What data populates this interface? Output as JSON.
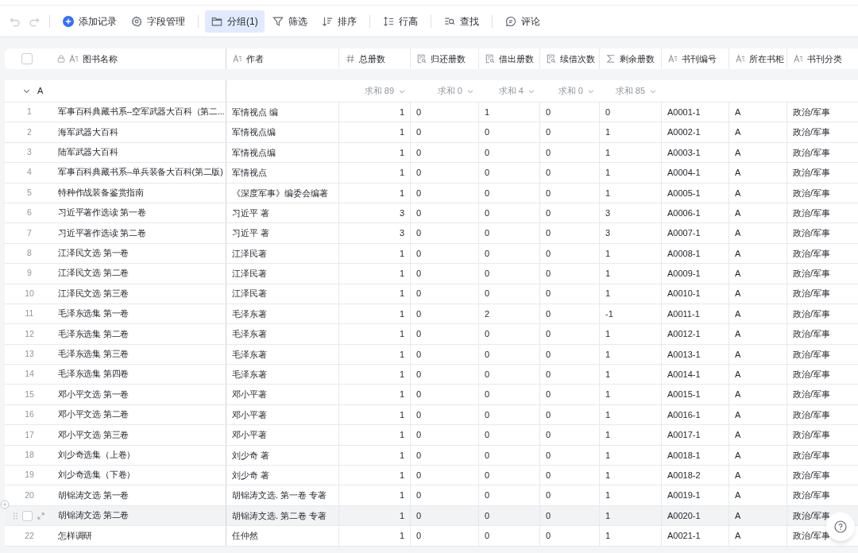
{
  "toolbar": [
    {
      "kind": "undo",
      "disabled": true
    },
    {
      "kind": "redo",
      "disabled": true
    },
    {
      "kind": "separator"
    },
    {
      "kind": "add",
      "label": "添加记录",
      "selected": false
    },
    {
      "kind": "fields",
      "label": "字段管理",
      "selected": false
    },
    {
      "kind": "separator"
    },
    {
      "kind": "group",
      "label": "分组(1)",
      "selected": true
    },
    {
      "kind": "filter",
      "label": "筛选",
      "selected": false
    },
    {
      "kind": "sort",
      "label": "排序",
      "selected": false
    },
    {
      "kind": "separator"
    },
    {
      "kind": "row_height",
      "label": "行高",
      "selected": false
    },
    {
      "kind": "separator"
    },
    {
      "kind": "find",
      "label": "查找",
      "selected": false
    },
    {
      "kind": "separator"
    },
    {
      "kind": "comment",
      "label": "评论",
      "selected": false
    }
  ],
  "table": {
    "select_all": {
      "checked": false
    },
    "columns": [
      {
        "label": "图书名称",
        "kind": "primary"
      },
      {
        "label": "作者",
        "kind": "text"
      },
      {
        "label": "总册数",
        "kind": "number",
        "summary": "求和 89"
      },
      {
        "label": "归还册数",
        "kind": "lookup",
        "summary": "求和 0"
      },
      {
        "label": "借出册数",
        "kind": "lookup",
        "summary": "求和 4"
      },
      {
        "label": "续借次数",
        "kind": "lookup",
        "summary": "求和 0"
      },
      {
        "label": "剩余册数",
        "kind": "formula",
        "summary": "求和 85"
      },
      {
        "label": "书刊编号",
        "kind": "text"
      },
      {
        "label": "所在书柜",
        "kind": "text"
      },
      {
        "label": "书刊分类",
        "kind": "text"
      }
    ],
    "group": {
      "label": "A",
      "expanded": true
    },
    "rows": [
      {
        "index": "1",
        "hovered": false,
        "cells": [
          "军事百科典藏书系--空军武器大百科（第二...",
          "军情视点 编",
          "1",
          "0",
          "1",
          "0",
          "0",
          "A0001-1",
          "A",
          "政治/军事"
        ]
      },
      {
        "index": "2",
        "hovered": false,
        "cells": [
          "海军武器大百科",
          "军情视点编",
          "1",
          "0",
          "0",
          "0",
          "1",
          "A0002-1",
          "A",
          "政治/军事"
        ]
      },
      {
        "index": "3",
        "hovered": false,
        "cells": [
          "陆军武器大百科",
          "军情视点编",
          "1",
          "0",
          "0",
          "0",
          "1",
          "A0003-1",
          "A",
          "政治/军事"
        ]
      },
      {
        "index": "4",
        "hovered": false,
        "cells": [
          "军事百科典藏书系--单兵装备大百科(第二版)",
          "军情视点",
          "1",
          "0",
          "0",
          "0",
          "1",
          "A0004-1",
          "A",
          "政治/军事"
        ]
      },
      {
        "index": "5",
        "hovered": false,
        "cells": [
          "特种作战装备鉴赏指南",
          "《深度军事》编委会编著",
          "1",
          "0",
          "0",
          "0",
          "1",
          "A0005-1",
          "A",
          "政治/军事"
        ]
      },
      {
        "index": "6",
        "hovered": false,
        "cells": [
          "习近平著作选读 第一卷",
          "习近平 著",
          "3",
          "0",
          "0",
          "0",
          "3",
          "A0006-1",
          "A",
          "政治/军事"
        ]
      },
      {
        "index": "7",
        "hovered": false,
        "cells": [
          "习近平著作选读 第二卷",
          "习近平 著",
          "3",
          "0",
          "0",
          "0",
          "3",
          "A0007-1",
          "A",
          "政治/军事"
        ]
      },
      {
        "index": "8",
        "hovered": false,
        "cells": [
          "江泽民文选 第一卷",
          "江泽民著",
          "1",
          "0",
          "0",
          "0",
          "1",
          "A0008-1",
          "A",
          "政治/军事"
        ]
      },
      {
        "index": "9",
        "hovered": false,
        "cells": [
          "江泽民文选 第二卷",
          "江泽民著",
          "1",
          "0",
          "0",
          "0",
          "1",
          "A0009-1",
          "A",
          "政治/军事"
        ]
      },
      {
        "index": "10",
        "hovered": false,
        "cells": [
          "江泽民文选 第三卷",
          "江泽民著",
          "1",
          "0",
          "0",
          "0",
          "1",
          "A0010-1",
          "A",
          "政治/军事"
        ]
      },
      {
        "index": "11",
        "hovered": false,
        "cells": [
          "毛泽东选集 第一卷",
          "毛泽东著",
          "1",
          "0",
          "2",
          "0",
          "-1",
          "A0011-1",
          "A",
          "政治/军事"
        ]
      },
      {
        "index": "12",
        "hovered": false,
        "cells": [
          "毛泽东选集 第二卷",
          "毛泽东著",
          "1",
          "0",
          "0",
          "0",
          "1",
          "A0012-1",
          "A",
          "政治/军事"
        ]
      },
      {
        "index": "13",
        "hovered": false,
        "cells": [
          "毛泽东选集 第三卷",
          "毛泽东著",
          "1",
          "0",
          "0",
          "0",
          "1",
          "A0013-1",
          "A",
          "政治/军事"
        ]
      },
      {
        "index": "14",
        "hovered": false,
        "cells": [
          "毛泽东选集 第四卷",
          "毛泽东著",
          "1",
          "0",
          "0",
          "0",
          "1",
          "A0014-1",
          "A",
          "政治/军事"
        ]
      },
      {
        "index": "15",
        "hovered": false,
        "cells": [
          "邓小平文选 第一卷",
          "邓小平著",
          "1",
          "0",
          "0",
          "0",
          "1",
          "A0015-1",
          "A",
          "政治/军事"
        ]
      },
      {
        "index": "16",
        "hovered": false,
        "cells": [
          "邓小平文选 第二卷",
          "邓小平著",
          "1",
          "0",
          "0",
          "0",
          "1",
          "A0016-1",
          "A",
          "政治/军事"
        ]
      },
      {
        "index": "17",
        "hovered": false,
        "cells": [
          "邓小平文选 第三卷",
          "邓小平著",
          "1",
          "0",
          "0",
          "0",
          "1",
          "A0017-1",
          "A",
          "政治/军事"
        ]
      },
      {
        "index": "18",
        "hovered": false,
        "cells": [
          "刘少奇选集（上卷）",
          "刘少奇 著",
          "1",
          "0",
          "0",
          "0",
          "1",
          "A0018-1",
          "A",
          "政治/军事"
        ]
      },
      {
        "index": "19",
        "hovered": false,
        "cells": [
          "刘少奇选集（下卷）",
          "刘少奇 著",
          "1",
          "0",
          "0",
          "0",
          "1",
          "A0018-2",
          "A",
          "政治/军事"
        ]
      },
      {
        "index": "20",
        "hovered": false,
        "cells": [
          "胡锦涛文选 第一卷",
          "胡锦涛文选. 第一卷 专著",
          "1",
          "0",
          "0",
          "0",
          "1",
          "A0019-1",
          "A",
          "政治/军事"
        ]
      },
      {
        "hovered": true,
        "checked": false,
        "cells": [
          "胡锦涛文选 第二卷",
          "胡锦涛文选. 第二卷 专著",
          "1",
          "0",
          "0",
          "0",
          "1",
          "A0020-1",
          "A",
          "政治/军事"
        ]
      },
      {
        "index": "22",
        "hovered": false,
        "cells": [
          "怎样调研",
          "任仲然",
          "1",
          "0",
          "0",
          "0",
          "1",
          "A0021-1",
          "A",
          "政治/军事"
        ]
      }
    ]
  }
}
